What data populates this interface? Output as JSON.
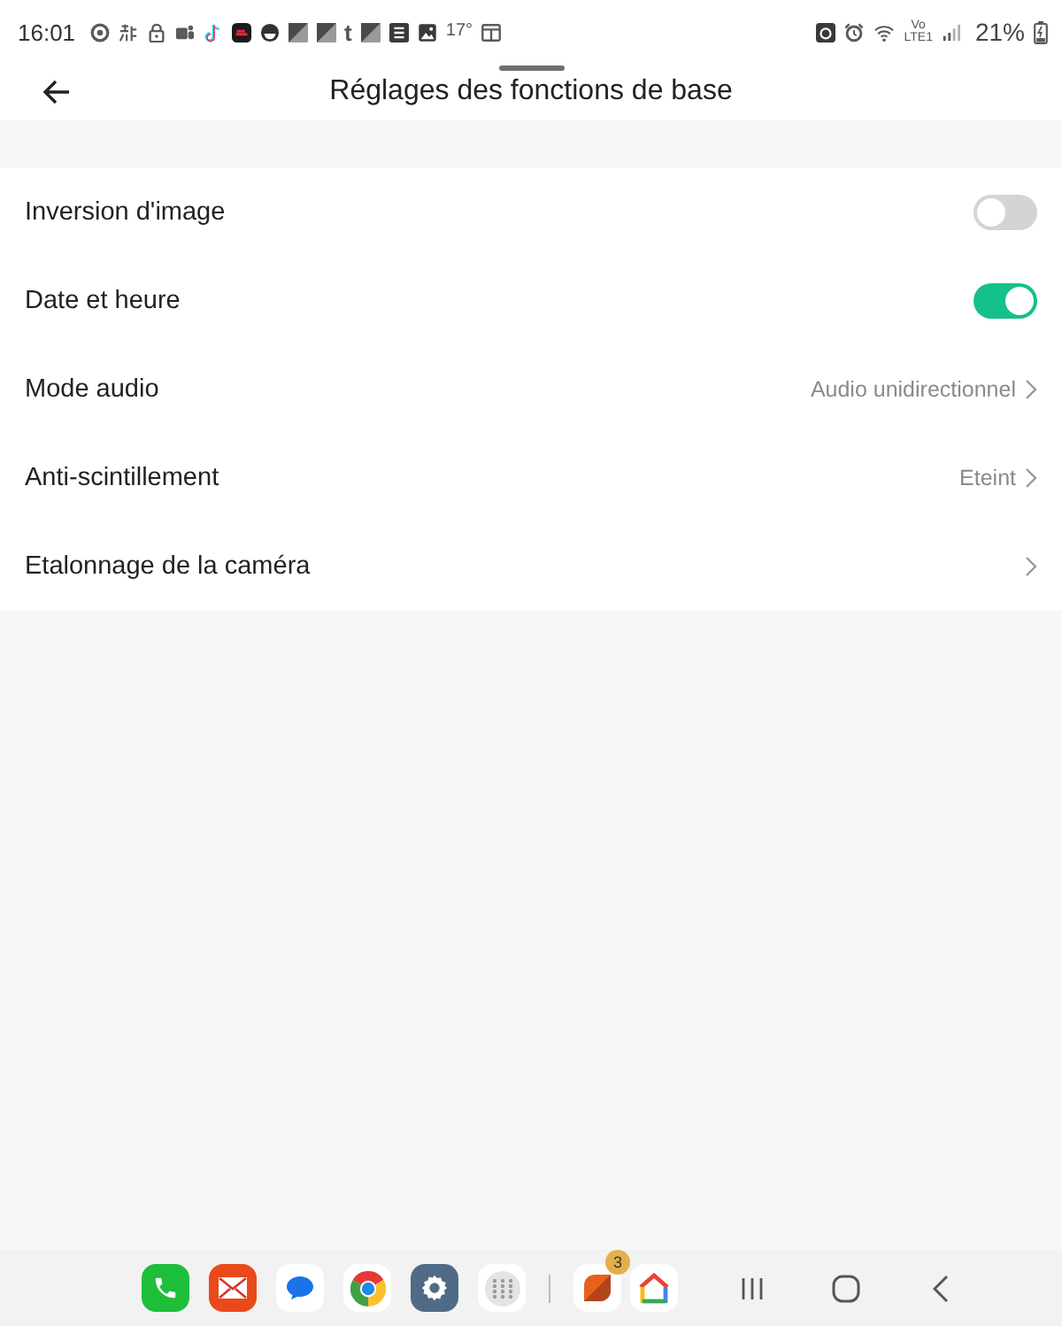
{
  "status_bar": {
    "time": "16:01",
    "glyph_icon": "t",
    "temperature": "17°",
    "network_top": "Vo",
    "network_bottom": "LTE1",
    "battery": "21%"
  },
  "header": {
    "title": "Réglages des fonctions de base"
  },
  "settings": [
    {
      "kind": "toggle",
      "label": "Inversion d'image",
      "on": false
    },
    {
      "kind": "toggle",
      "label": "Date et heure",
      "on": true
    },
    {
      "kind": "link",
      "label": "Mode audio",
      "value": "Audio unidirectionnel"
    },
    {
      "kind": "link",
      "label": "Anti-scintillement",
      "value": "Eteint"
    },
    {
      "kind": "link",
      "label": "Etalonnage de la caméra"
    }
  ],
  "taskbar": {
    "badge": "3"
  }
}
